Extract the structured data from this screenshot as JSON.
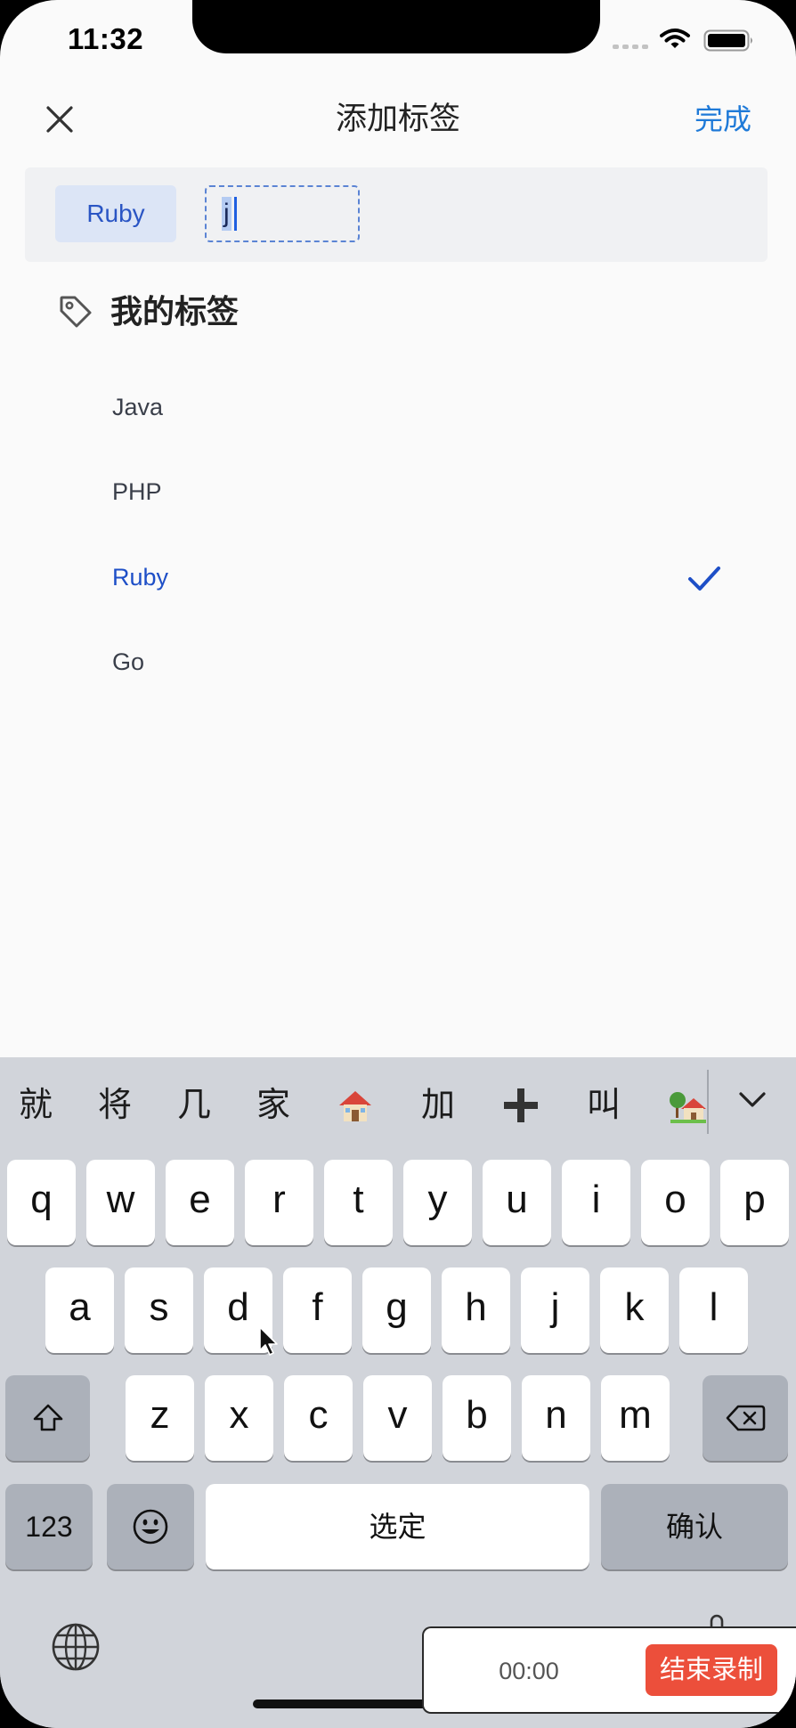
{
  "status_bar": {
    "time": "11:32"
  },
  "nav": {
    "title": "添加标签",
    "done_label": "完成"
  },
  "tag_input": {
    "tags": [
      {
        "label": "Ruby"
      }
    ],
    "marked_text": "j"
  },
  "my_tags": {
    "heading": "我的标签",
    "items": [
      {
        "label": "Java",
        "selected": false
      },
      {
        "label": "PHP",
        "selected": false
      },
      {
        "label": "Ruby",
        "selected": true
      },
      {
        "label": "Go",
        "selected": false
      }
    ]
  },
  "keyboard": {
    "candidates": [
      {
        "text": "就"
      },
      {
        "text": "将"
      },
      {
        "text": "几"
      },
      {
        "text": "家"
      },
      {
        "icon": "house-emoji-icon"
      },
      {
        "text": "加"
      },
      {
        "icon": "heavy-plus-emoji-icon"
      },
      {
        "text": "叫"
      },
      {
        "icon": "house-with-garden-emoji-icon"
      }
    ],
    "rows": [
      [
        "q",
        "w",
        "e",
        "r",
        "t",
        "y",
        "u",
        "i",
        "o",
        "p"
      ],
      [
        "a",
        "s",
        "d",
        "f",
        "g",
        "h",
        "j",
        "k",
        "l"
      ],
      [
        "z",
        "x",
        "c",
        "v",
        "b",
        "n",
        "m"
      ]
    ],
    "numbers_label": "123",
    "space_label": "选定",
    "return_label": "确认"
  },
  "recording": {
    "timer": "00:00",
    "stop_label": "结束录制"
  },
  "colors": {
    "accent": "#1f7ad8",
    "selected": "#1e4fc7",
    "record": "#ec4f3b"
  }
}
